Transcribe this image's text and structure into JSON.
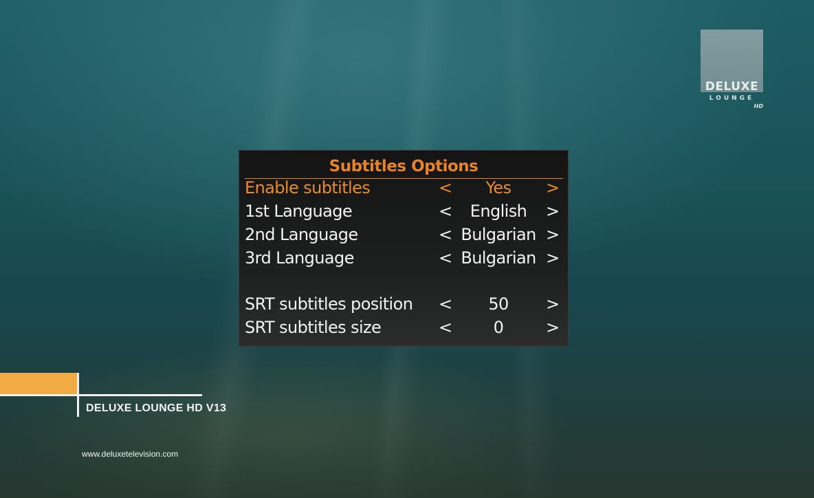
{
  "logo": {
    "line1": "DELUXE",
    "line2": "LOUNGE",
    "line3": "HD"
  },
  "menu": {
    "title": "Subtitles Options",
    "arrow_left": "<",
    "arrow_right": ">",
    "accent_color": "#e8832a",
    "rows": [
      {
        "label": "Enable subtitles",
        "value": "Yes",
        "selected": true
      },
      {
        "label": "1st Language",
        "value": "English",
        "selected": false
      },
      {
        "label": "2nd Language",
        "value": "Bulgarian",
        "selected": false
      },
      {
        "label": "3rd Language",
        "value": "Bulgarian",
        "selected": false
      },
      {
        "label": "SRT subtitles position",
        "value": "50",
        "selected": false
      },
      {
        "label": "SRT subtitles size",
        "value": "0",
        "selected": false
      }
    ]
  },
  "branding": {
    "channel_name": "DELUXE LOUNGE HD V13",
    "website": "www.deluxetelevision.com",
    "bar_color": "#f0ac43"
  }
}
